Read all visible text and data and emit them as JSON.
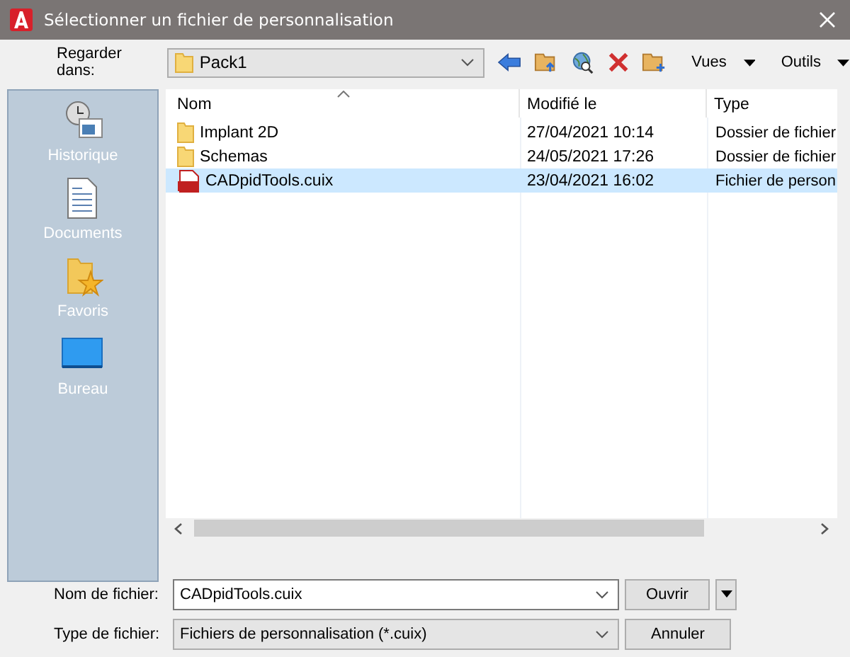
{
  "window": {
    "title": "Sélectionner un fichier de personnalisation"
  },
  "look_in": {
    "label": "Regarder dans:",
    "value": "Pack1"
  },
  "menus": [
    {
      "label": "Vues"
    },
    {
      "label": "Outils"
    }
  ],
  "places": [
    {
      "label": "Historique",
      "kind": "history"
    },
    {
      "label": "Documents",
      "kind": "documents"
    },
    {
      "label": "Favoris",
      "kind": "favorites"
    },
    {
      "label": "Bureau",
      "kind": "desktop"
    }
  ],
  "columns": [
    "Nom",
    "Modifié le",
    "Type"
  ],
  "files": [
    {
      "name": "Implant 2D",
      "kind": "folder",
      "modified": "27/04/2021 10:14",
      "type": "Dossier de fichier",
      "selected": false
    },
    {
      "name": "Schemas",
      "kind": "folder",
      "modified": "24/05/2021 17:26",
      "type": "Dossier de fichier",
      "selected": false
    },
    {
      "name": "CADpidTools.cuix",
      "kind": "cuix",
      "modified": "23/04/2021 16:02",
      "type": "Fichier de person",
      "selected": true
    }
  ],
  "file_name": {
    "label": "Nom de fichier:",
    "value": "CADpidTools.cuix"
  },
  "file_type": {
    "label": "Type de fichier:",
    "value": "Fichiers de personnalisation (*.cuix)"
  },
  "buttons": {
    "open": "Ouvrir",
    "cancel": "Annuler"
  }
}
